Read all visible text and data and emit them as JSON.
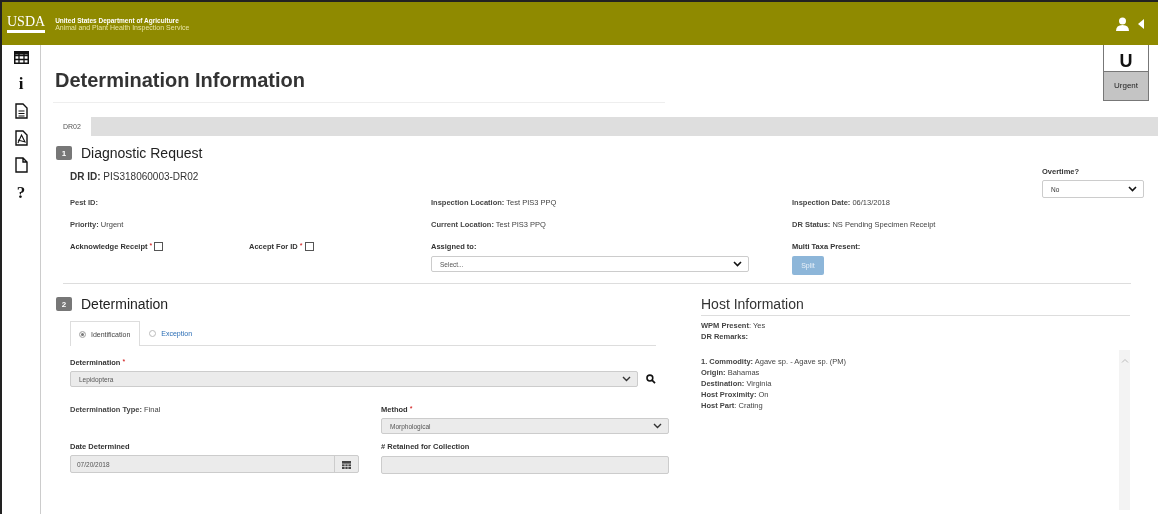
{
  "header": {
    "logo": "USDA",
    "agency": "United States Department of Agriculture",
    "service": "Animal and Plant Health Inspection Service"
  },
  "sidebar": {
    "items": [
      {
        "kind": "table"
      },
      {
        "kind": "glyph",
        "glyph": "i"
      },
      {
        "kind": "document"
      },
      {
        "kind": "pdf"
      },
      {
        "kind": "page"
      },
      {
        "kind": "glyph",
        "glyph": "?"
      }
    ]
  },
  "priority_badge": {
    "letter": "U",
    "label": "Urgent"
  },
  "page_title": "Determination Information",
  "tabs": [
    {
      "label": "DR02",
      "selected": true
    }
  ],
  "diagnostic_request": {
    "number": "1",
    "title": "Diagnostic Request",
    "dr_id": "**DR ID:** PIS318060003-DR02",
    "overtime": {
      "label": "Overtime?",
      "value": "No"
    },
    "fields": [
      {
        "text": "**Pest ID:**"
      },
      {
        "text": "**Inspection Location:** Test PIS3 PPQ"
      },
      {
        "text": "**Inspection Date:** 06/13/2018"
      },
      {
        "text": "**Priority:** Urgent"
      },
      {
        "text": "**Current Location:** Test PIS3 PPQ"
      },
      {
        "text": "**DR Status:** NS Pending Specimen Receipt"
      }
    ],
    "checkboxes": [
      {
        "label": "Acknowledge Receipt",
        "required_mark": "*",
        "checked": false
      },
      {
        "label": "Accept For ID",
        "required_mark": "*",
        "checked": false
      }
    ],
    "assigned_to": {
      "label": "Assigned to:",
      "placeholder": "Select..."
    },
    "multi_taxa": {
      "label": "Multi Taxa Present:",
      "button": "Split",
      "disabled": true
    }
  },
  "determination": {
    "number": "2",
    "title": "Determination",
    "tabs": [
      {
        "label": "Identification",
        "selected": true
      },
      {
        "label": "Exception",
        "selected": false
      }
    ],
    "determination": {
      "label": "Determination",
      "required_mark": "*",
      "value": "Lepidoptera"
    },
    "determination_type": "**Determination Type:** Final",
    "method": {
      "label": "Method",
      "required_mark": "*",
      "value": "Morphological"
    },
    "date_determined": {
      "label": "Date Determined",
      "value": "07/20/2018"
    },
    "retained": {
      "label": "# Retained for Collection"
    }
  },
  "host_information": {
    "title": "Host Information",
    "summary": [
      "**WPM Present**: Yes",
      "**DR Remarks:**"
    ],
    "details": [
      "**1. Commodity:** Agave sp. - Agave sp. (PM)",
      "**Origin:** Bahamas",
      "**Destination:** Virginia",
      "**Host Proximity:** On",
      "**Host Part**: Crating"
    ]
  }
}
